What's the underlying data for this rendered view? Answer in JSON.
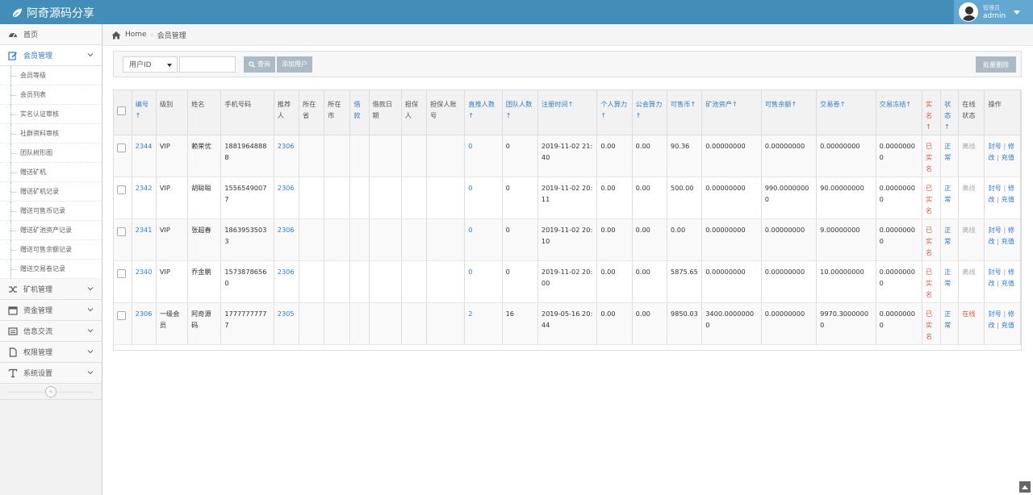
{
  "brand": {
    "title": "阿奇源码分享"
  },
  "user": {
    "role": "管理员",
    "name": "admin"
  },
  "sidebar": {
    "home": "首页",
    "member_group": "会员管理",
    "sub_items": [
      "会员等级",
      "会员列表",
      "实名认证审核",
      "社群资料审核",
      "团队树形图",
      "赠送矿机",
      "赠送矿机记录",
      "赠送可售币记录",
      "赠送矿池资产记录",
      "赠送可售余额记录",
      "赠送交易卷记录"
    ],
    "groups": [
      "矿机管理",
      "资金管理",
      "信息交流",
      "权限管理",
      "系统设置"
    ],
    "collapse_symbol": "«"
  },
  "breadcrumb": {
    "home": "Home",
    "current": "会员管理"
  },
  "toolbar": {
    "select_value": "用户ID",
    "query_label": "查询",
    "add_label": "添加用户",
    "delete_label": "批量删除"
  },
  "table": {
    "headers": [
      "编号↑",
      "级别",
      "姓名",
      "手机号码",
      "推荐人",
      "所在省",
      "所在市",
      "借款",
      "借款日期",
      "担保人",
      "担保人账号",
      "直推人数↑",
      "团队人数↑",
      "注册时间↑",
      "个人算力↑",
      "公会算力↑",
      "可售币↑",
      "矿池资产↑",
      "可售余额↑",
      "交易卷↑",
      "交易冻结↑",
      "实名↑",
      "状态↑",
      "在线状态",
      "操作"
    ],
    "rows": [
      {
        "id": "2344",
        "level": "VIP",
        "name": "赖荣优",
        "phone": "18819648888",
        "referrer": "2306",
        "province": "",
        "city": "",
        "loan": "",
        "loan_date": "",
        "guarantor": "",
        "guarantor_account": "",
        "direct": "0",
        "team": "0",
        "reg_time": "2019-11-02 21:40",
        "personal": "0.00",
        "guild": "0.00",
        "coin": "90.36",
        "pool": "0.00000000",
        "balance": "0.00000000",
        "voucher": "0.00000000",
        "frozen": "0.00000000",
        "verified": "已实名",
        "status": "正常",
        "online": "离线",
        "op1": "封号",
        "op2": "修改",
        "op3": "充值"
      },
      {
        "id": "2342",
        "level": "VIP",
        "name": "胡聪聪",
        "phone": "15565490077",
        "referrer": "2306",
        "province": "",
        "city": "",
        "loan": "",
        "loan_date": "",
        "guarantor": "",
        "guarantor_account": "",
        "direct": "0",
        "team": "0",
        "reg_time": "2019-11-02 20:11",
        "personal": "0.00",
        "guild": "0.00",
        "coin": "500.00",
        "pool": "0.00000000",
        "balance": "990.00000000",
        "voucher": "90.00000000",
        "frozen": "0.00000000",
        "verified": "已实名",
        "status": "正常",
        "online": "离线",
        "op1": "封号",
        "op2": "修改",
        "op3": "充值"
      },
      {
        "id": "2341",
        "level": "VIP",
        "name": "张超春",
        "phone": "18639535033",
        "referrer": "2306",
        "province": "",
        "city": "",
        "loan": "",
        "loan_date": "",
        "guarantor": "",
        "guarantor_account": "",
        "direct": "0",
        "team": "0",
        "reg_time": "2019-11-02 20:10",
        "personal": "0.00",
        "guild": "0.00",
        "coin": "0.00",
        "pool": "0.00000000",
        "balance": "0.00000000",
        "voucher": "9.00000000",
        "frozen": "0.00000000",
        "verified": "已实名",
        "status": "正常",
        "online": "离线",
        "op1": "封号",
        "op2": "修改",
        "op3": "充值"
      },
      {
        "id": "2340",
        "level": "VIP",
        "name": "乔金鹏",
        "phone": "15738786560",
        "referrer": "2306",
        "province": "",
        "city": "",
        "loan": "",
        "loan_date": "",
        "guarantor": "",
        "guarantor_account": "",
        "direct": "0",
        "team": "0",
        "reg_time": "2019-11-02 20:00",
        "personal": "0.00",
        "guild": "0.00",
        "coin": "5875.65",
        "pool": "0.00000000",
        "balance": "0.00000000",
        "voucher": "10.00000000",
        "frozen": "0.00000000",
        "verified": "已实名",
        "status": "正常",
        "online": "离线",
        "op1": "封号",
        "op2": "修改",
        "op3": "充值"
      },
      {
        "id": "2306",
        "level": "一级会员",
        "name": "阿奇源码",
        "phone": "17777777777",
        "referrer": "2305",
        "province": "",
        "city": "",
        "loan": "",
        "loan_date": "",
        "guarantor": "",
        "guarantor_account": "",
        "direct": "2",
        "team": "16",
        "reg_time": "2019-05-16 20:44",
        "personal": "0.00",
        "guild": "0.00",
        "coin": "9850.03",
        "pool": "3400.00000000",
        "balance": "0.00000000",
        "voucher": "9970.30000000",
        "frozen": "0.00000000",
        "verified": "已实名",
        "status": "正常",
        "online": "在线",
        "op1": "封号",
        "op2": "修改",
        "op3": "充值"
      }
    ]
  },
  "colors": {
    "topbar": "#438eb9",
    "link": "#307ecc",
    "danger": "#dd5a43",
    "button": "#abbac3"
  }
}
